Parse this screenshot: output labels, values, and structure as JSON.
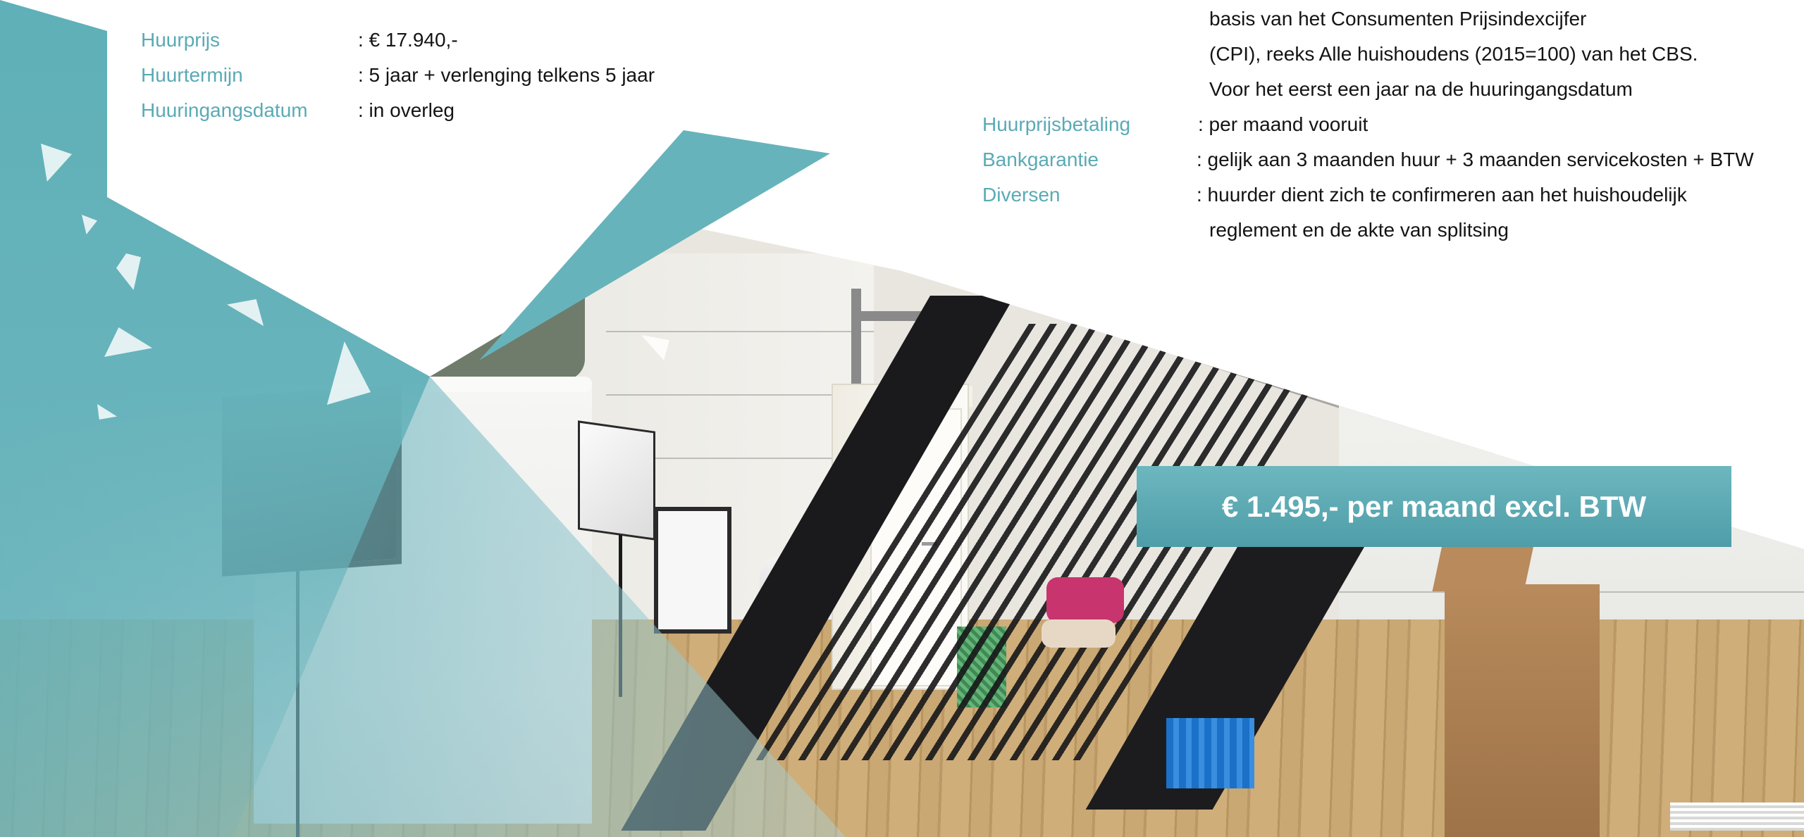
{
  "left_terms": [
    {
      "label": "Huurprijs",
      "value": ": € 17.940,-"
    },
    {
      "label": "Huurtermijn",
      "value": ": 5 jaar + verlenging telkens 5 jaar"
    },
    {
      "label": "Huuringangsdatum",
      "value": ": in overleg"
    }
  ],
  "right_terms": {
    "indexation_lines": [
      "basis van het  Consumenten Prijsindexcijfer",
      "(CPI), reeks Alle huishoudens (2015=100) van het CBS.",
      "Voor het eerst een jaar na de huuringangsdatum"
    ],
    "items": [
      {
        "label": "Huurprijsbetaling",
        "value": ": per maand vooruit"
      },
      {
        "label": "Bankgarantie",
        "value": ": gelijk aan 3 maanden huur + 3 maanden servicekosten + BTW"
      },
      {
        "label": "Diversen",
        "value": ": huurder dient zich te confirmeren aan het huishoudelijk",
        "continuation": "reglement en de akte van splitsing"
      }
    ]
  },
  "price_banner": "€ 1.495,- per maand excl. BTW",
  "colors": {
    "teal": "#67b3bb",
    "label_teal": "#5aaab5",
    "text": "#141414"
  }
}
